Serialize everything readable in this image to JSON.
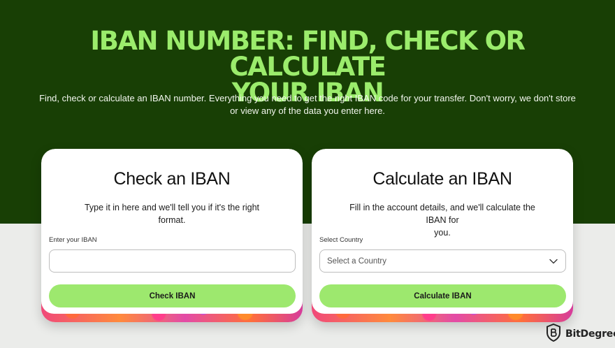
{
  "hero": {
    "title_line1": "IBAN NUMBER: FIND, CHECK OR CALCULATE",
    "title_line2": "YOUR IBAN",
    "subtitle_line1": "Find, check or calculate an IBAN number. Everything you need to get the right IBAN code for your transfer. Don't worry, we don't store",
    "subtitle_line2": "or view any of the data you enter here."
  },
  "check_card": {
    "title": "Check an IBAN",
    "desc_line1": "Type it in here and we'll tell you if it's the right",
    "desc_line2": "format.",
    "field_label": "Enter your IBAN",
    "input_value": "",
    "button_label": "Check IBAN"
  },
  "calc_card": {
    "title": "Calculate an IBAN",
    "desc_line1": "Fill in the account details, and we'll calculate the IBAN for",
    "desc_line2": "you.",
    "field_label": "Select Country",
    "select_placeholder": "Select a Country",
    "button_label": "Calculate IBAN"
  },
  "watermark": {
    "brand": "BitDegree",
    "icon": "bitdegree-shield-icon"
  },
  "colors": {
    "hero_bg": "#183f05",
    "accent_green": "#9de86e",
    "title_green": "#9bec6c",
    "page_bg": "#ebecea"
  }
}
